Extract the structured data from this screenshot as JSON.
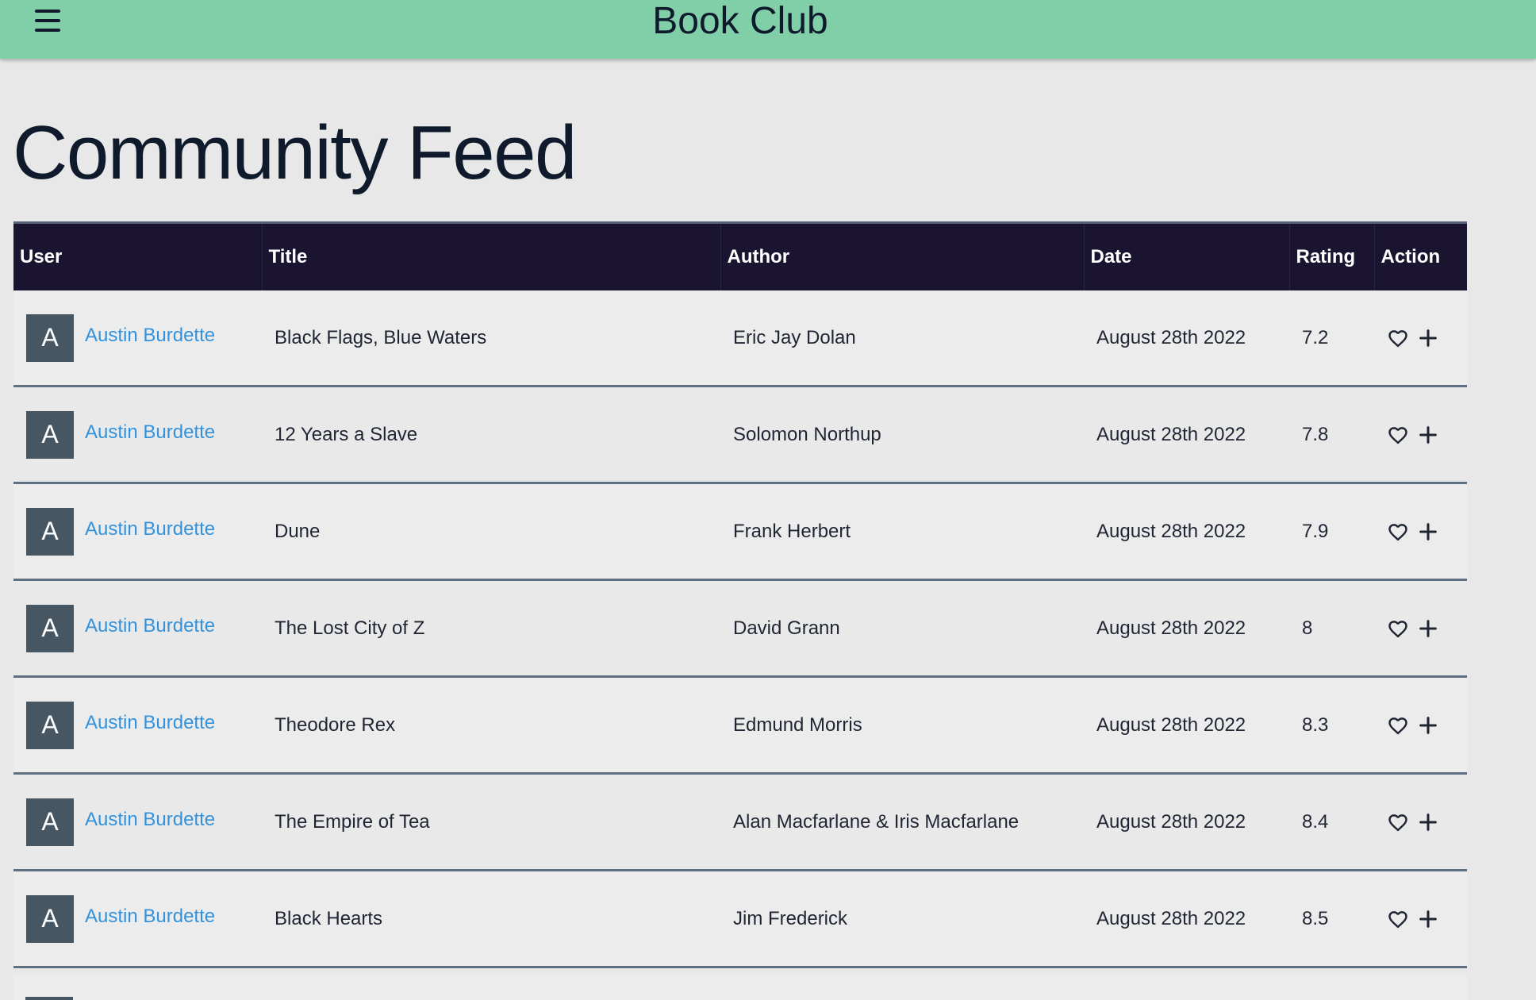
{
  "header": {
    "menu_icon": "hamburger-menu-icon",
    "title": "Book Club",
    "background": "#80cfa9"
  },
  "page": {
    "title": "Community Feed"
  },
  "table": {
    "columns": [
      "User",
      "Title",
      "Author",
      "Date",
      "Rating",
      "Action"
    ],
    "rows": [
      {
        "avatar": "A",
        "user": "Austin Burdette",
        "title": "Black Flags, Blue Waters",
        "author": "Eric Jay Dolan",
        "date": "August 28th 2022",
        "rating": "7.2"
      },
      {
        "avatar": "A",
        "user": "Austin Burdette",
        "title": "12 Years a Slave",
        "author": "Solomon Northup",
        "date": "August 28th 2022",
        "rating": "7.8"
      },
      {
        "avatar": "A",
        "user": "Austin Burdette",
        "title": "Dune",
        "author": "Frank Herbert",
        "date": "August 28th 2022",
        "rating": "7.9"
      },
      {
        "avatar": "A",
        "user": "Austin Burdette",
        "title": "The Lost City of Z",
        "author": "David Grann",
        "date": "August 28th 2022",
        "rating": "8"
      },
      {
        "avatar": "A",
        "user": "Austin Burdette",
        "title": "Theodore Rex",
        "author": "Edmund Morris",
        "date": "August 28th 2022",
        "rating": "8.3"
      },
      {
        "avatar": "A",
        "user": "Austin Burdette",
        "title": "The Empire of Tea",
        "author": "Alan Macfarlane & Iris Macfarlane",
        "date": "August 28th 2022",
        "rating": "8.4"
      },
      {
        "avatar": "A",
        "user": "Austin Burdette",
        "title": "Black Hearts",
        "author": "Jim Frederick",
        "date": "August 28th 2022",
        "rating": "8.5"
      }
    ],
    "action_icons": [
      "heart-icon",
      "plus-icon"
    ],
    "header_background": "#1a1430",
    "link_color": "#3392db",
    "avatar_color": "#465663"
  }
}
